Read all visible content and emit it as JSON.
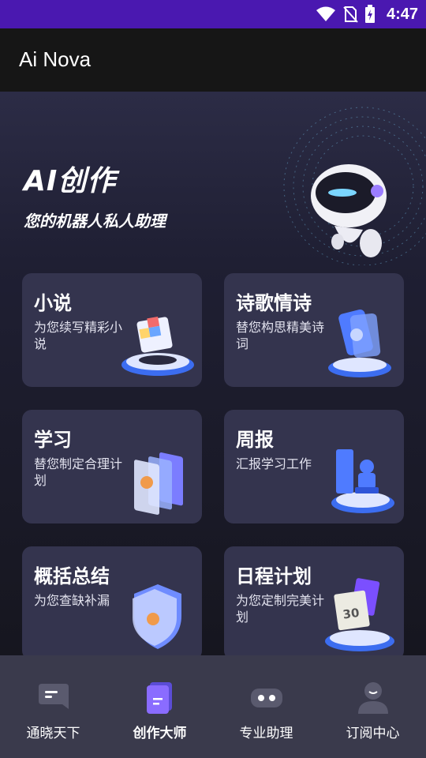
{
  "status_bar": {
    "time": "4:47"
  },
  "app_bar": {
    "title": "Ai Nova"
  },
  "hero": {
    "title": "AI创作",
    "subtitle": "您的机器人私人助理"
  },
  "cards": [
    {
      "title": "小说",
      "desc": "为您续写精彩小说",
      "icon": "cube-platform-icon"
    },
    {
      "title": "诗歌情诗",
      "desc": "替您构思精美诗词",
      "icon": "phone-platform-icon"
    },
    {
      "title": "学习",
      "desc": "替您制定合理计划",
      "icon": "panels-icon"
    },
    {
      "title": "周报",
      "desc": "汇报学习工作",
      "icon": "stamp-platform-icon"
    },
    {
      "title": "概括总结",
      "desc": "为您查缺补漏",
      "icon": "shield-icon"
    },
    {
      "title": "日程计划",
      "desc": "为您定制完美计划",
      "icon": "calendar-platform-icon",
      "badge": "30"
    }
  ],
  "bottom_nav": {
    "active": 1,
    "items": [
      {
        "label": "通晓天下",
        "icon": "chat-bubble-icon"
      },
      {
        "label": "创作大师",
        "icon": "document-icon"
      },
      {
        "label": "专业助理",
        "icon": "robot-face-icon"
      },
      {
        "label": "订阅中心",
        "icon": "person-icon"
      }
    ]
  }
}
